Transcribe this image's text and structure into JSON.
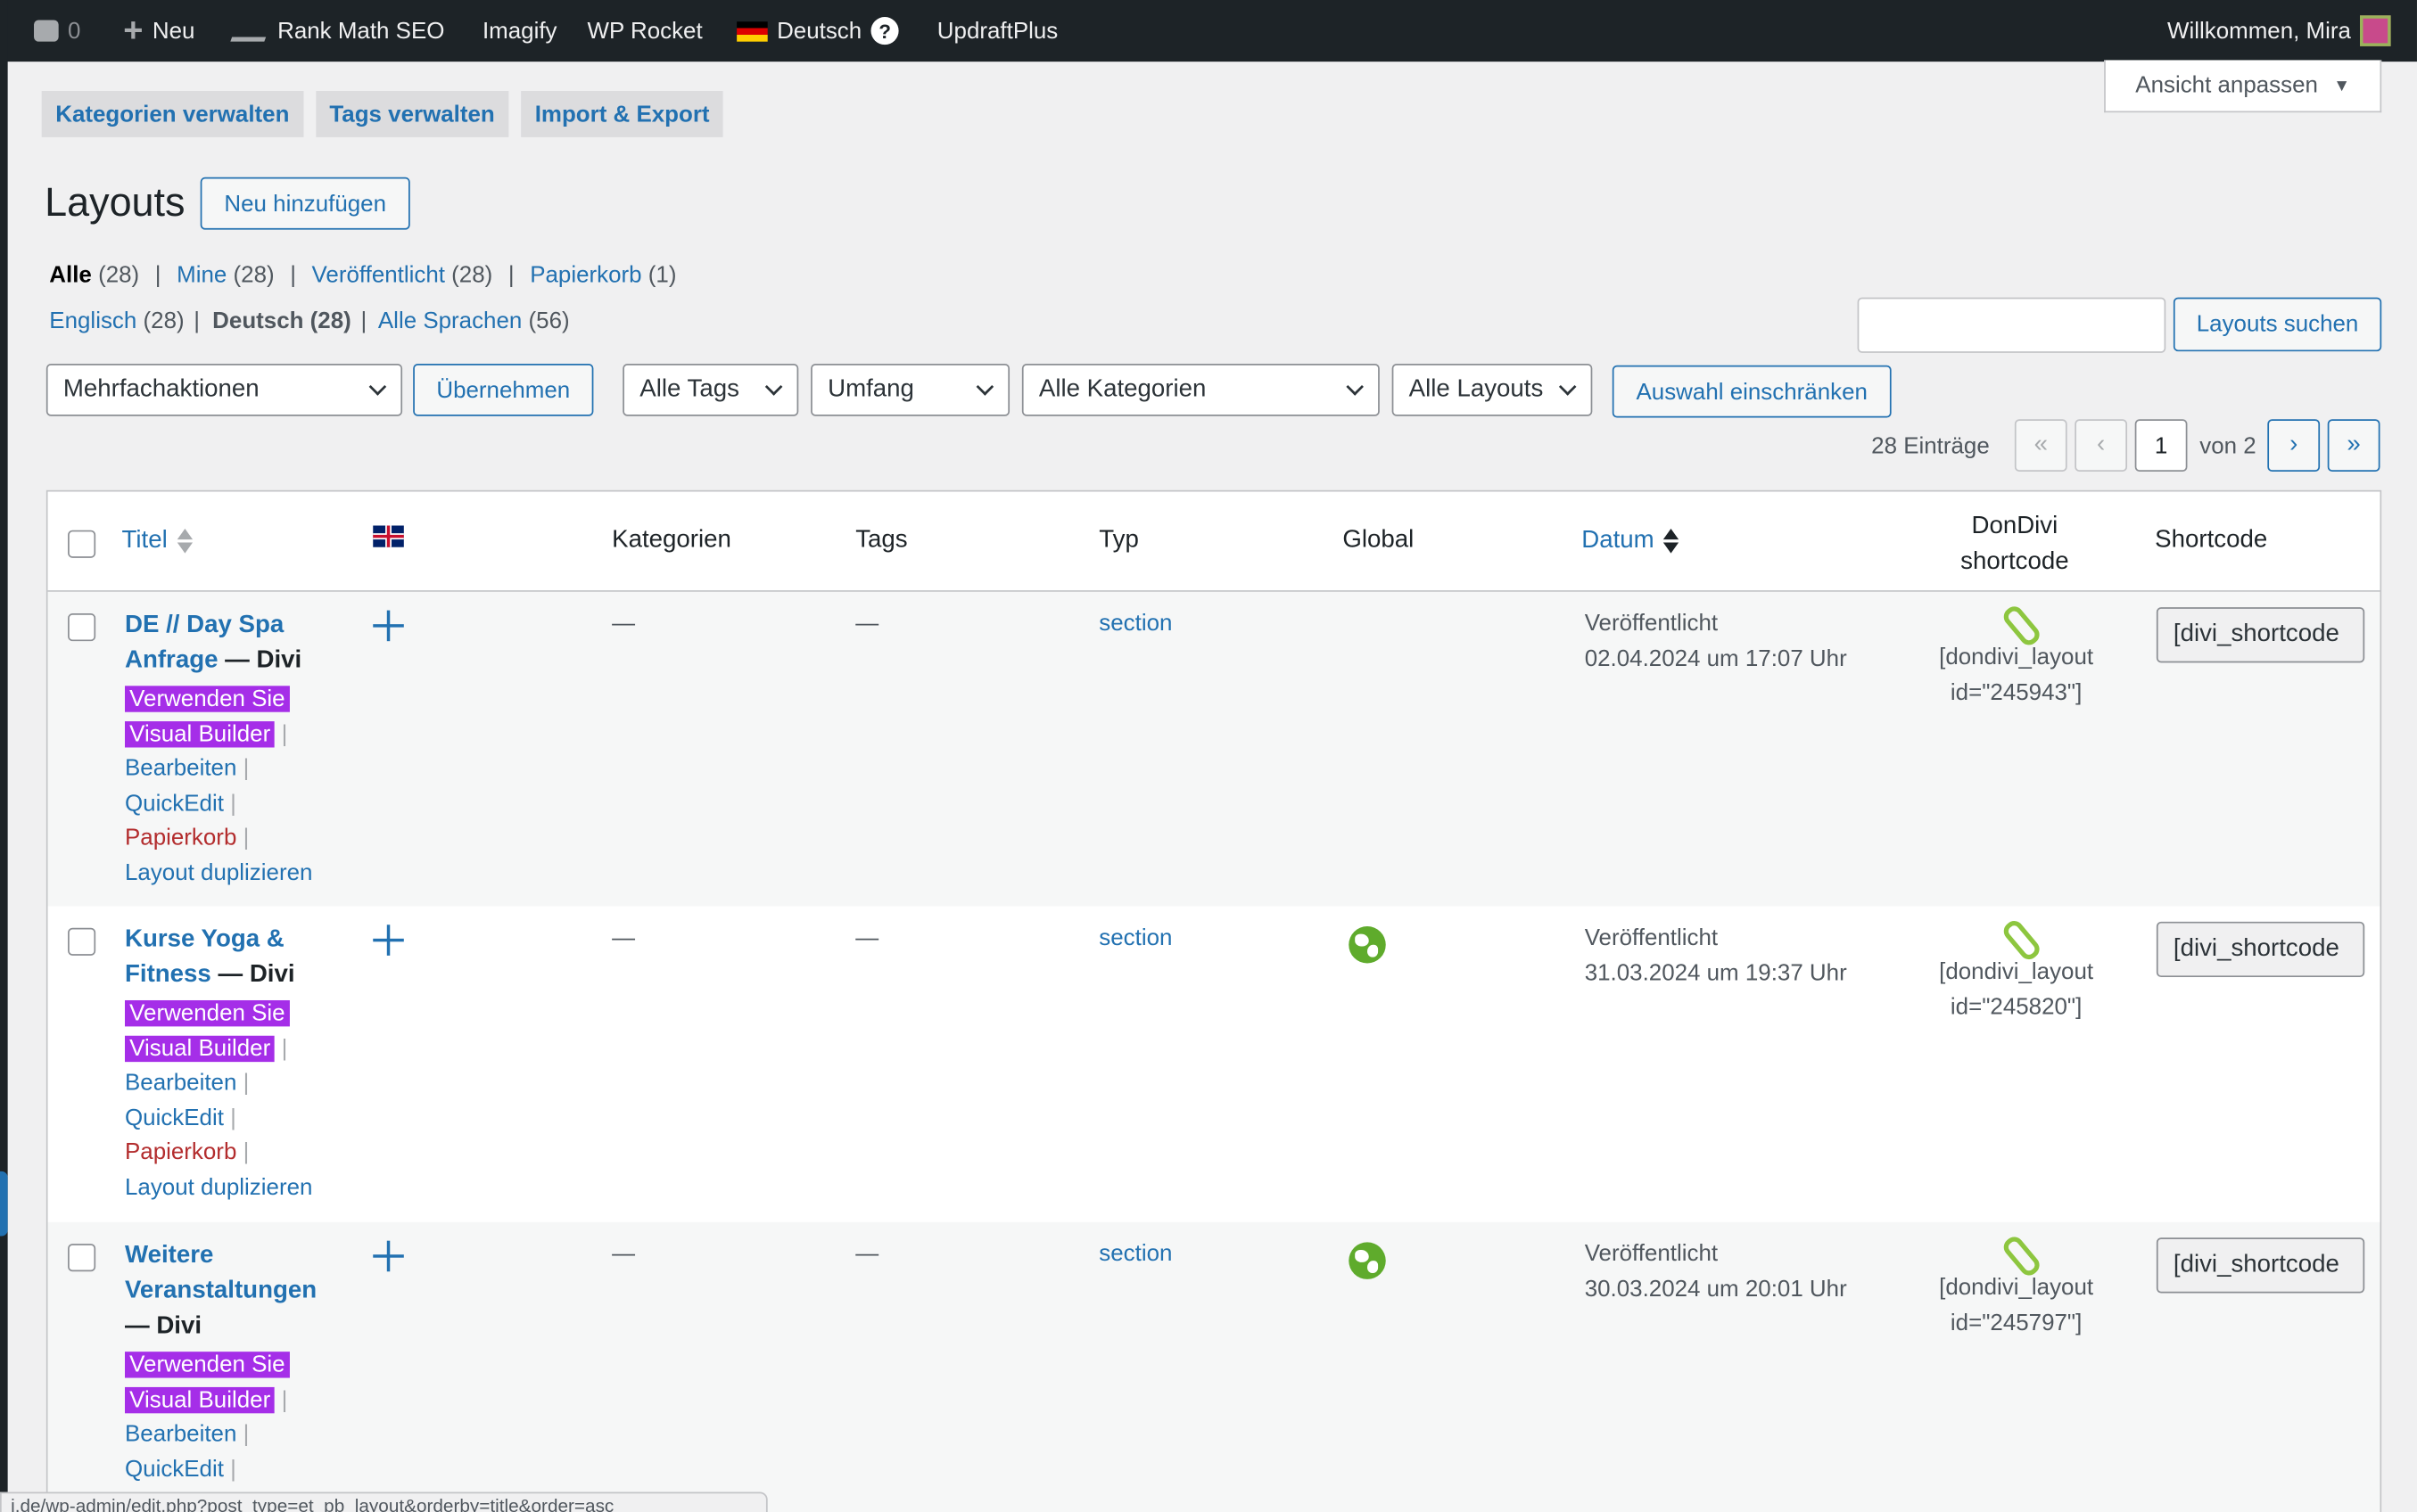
{
  "admin_bar": {
    "comments_count": "0",
    "new_label": "Neu",
    "rank_math": "Rank Math SEO",
    "imagify": "Imagify",
    "wp_rocket": "WP Rocket",
    "language": "Deutsch",
    "help": "?",
    "updraft": "UpdraftPlus",
    "greeting": "Willkommen, Mira"
  },
  "top_tabs": [
    "Kategorien verwalten",
    "Tags verwalten",
    "Import & Export"
  ],
  "screen_options": "Ansicht anpassen",
  "page": {
    "title": "Layouts",
    "add_new": "Neu hinzufügen"
  },
  "status_filters": {
    "all": "Alle",
    "all_count": "(28)",
    "mine": "Mine",
    "mine_count": "(28)",
    "published": "Veröffentlicht",
    "published_count": "(28)",
    "trash": "Papierkorb",
    "trash_count": "(1)"
  },
  "language_filters": {
    "en": "Englisch",
    "en_count": "(28)",
    "de": "Deutsch (28)",
    "all": "Alle Sprachen",
    "all_count": "(56)"
  },
  "search": {
    "button": "Layouts suchen",
    "value": ""
  },
  "bulk": {
    "action": "Mehrfachaktionen",
    "apply": "Übernehmen"
  },
  "filter_selects": {
    "tags": "Alle Tags",
    "scope": "Umfang",
    "categories": "Alle Kategorien",
    "layouts": "Alle Layouts",
    "submit": "Auswahl einschränken"
  },
  "pagination": {
    "items": "28 Einträge",
    "first": "«",
    "prev": "‹",
    "current": "1",
    "of": "von 2",
    "next": "›",
    "last": "»"
  },
  "columns": {
    "title": "Titel",
    "categories": "Kategorien",
    "tags": "Tags",
    "type": "Typ",
    "global": "Global",
    "date": "Datum",
    "dondivi_1": "DonDivi",
    "dondivi_2": "shortcode",
    "shortcode": "Shortcode"
  },
  "row_actions": {
    "vb_1": "Verwenden Sie",
    "vb_2": "Visual Builder",
    "edit": "Bearbeiten",
    "quickedit": "QuickEdit",
    "trash": "Papierkorb",
    "duplicate": "Layout duplizieren"
  },
  "rows": [
    {
      "title_1": "DE // Day Spa",
      "title_2": "Anfrage",
      "suffix": "— Divi",
      "categories": "—",
      "tags": "—",
      "type": "section",
      "global": false,
      "status": "Veröffentlicht",
      "date": "02.04.2024 um 17:07 Uhr",
      "dondivi_1": "[dondivi_layout",
      "dondivi_2": "id=\"245943\"]",
      "shortcode": "[divi_shortcode"
    },
    {
      "title_1": "Kurse Yoga &",
      "title_2": "Fitness",
      "suffix": "— Divi",
      "categories": "—",
      "tags": "—",
      "type": "section",
      "global": true,
      "status": "Veröffentlicht",
      "date": "31.03.2024 um 19:37 Uhr",
      "dondivi_1": "[dondivi_layout",
      "dondivi_2": "id=\"245820\"]",
      "shortcode": "[divi_shortcode"
    },
    {
      "title_1": "Weitere",
      "title_2": "Veranstaltungen",
      "suffix": "— Divi",
      "categories": "—",
      "tags": "—",
      "type": "section",
      "global": true,
      "status": "Veröffentlicht",
      "date": "30.03.2024 um 20:01 Uhr",
      "dondivi_1": "[dondivi_layout",
      "dondivi_2": "id=\"245797\"]",
      "shortcode": "[divi_shortcode"
    }
  ],
  "status_url": "i.de/wp-admin/edit.php?post_type=et_pb_layout&orderby=title&order=asc"
}
